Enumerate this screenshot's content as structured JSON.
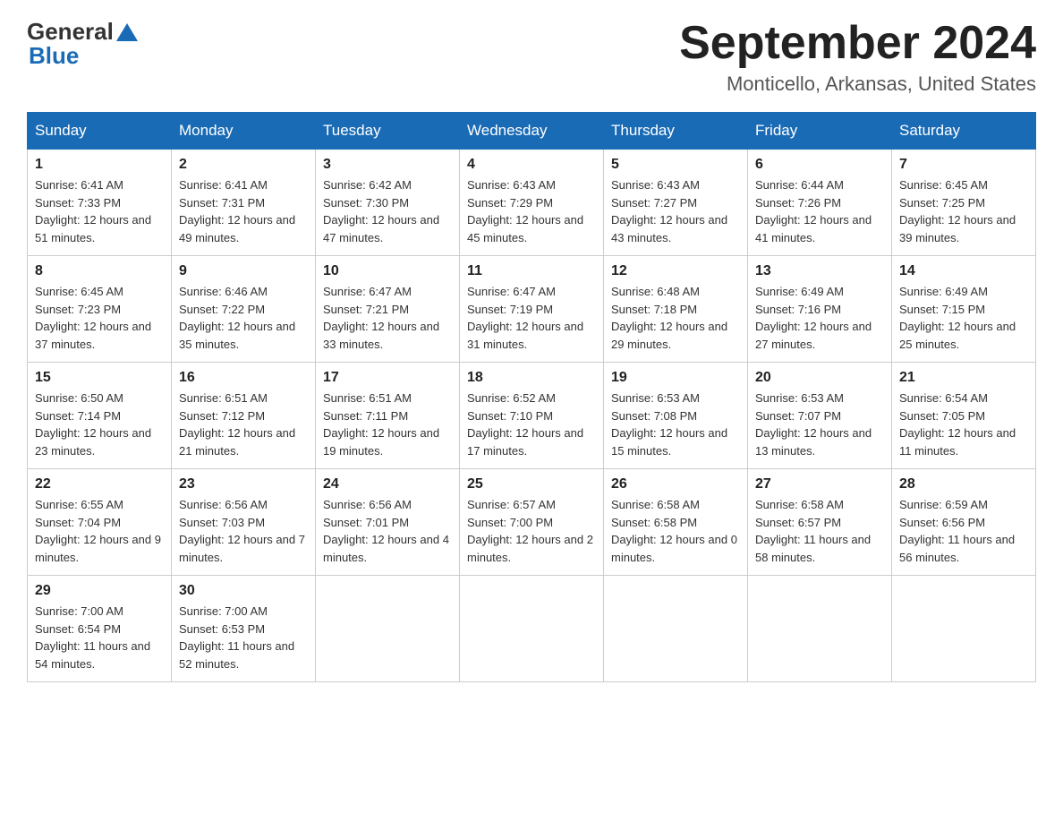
{
  "logo": {
    "general": "General",
    "blue": "Blue"
  },
  "header": {
    "title": "September 2024",
    "subtitle": "Monticello, Arkansas, United States"
  },
  "days_of_week": [
    "Sunday",
    "Monday",
    "Tuesday",
    "Wednesday",
    "Thursday",
    "Friday",
    "Saturday"
  ],
  "weeks": [
    [
      {
        "day": "1",
        "sunrise": "6:41 AM",
        "sunset": "7:33 PM",
        "daylight": "12 hours and 51 minutes."
      },
      {
        "day": "2",
        "sunrise": "6:41 AM",
        "sunset": "7:31 PM",
        "daylight": "12 hours and 49 minutes."
      },
      {
        "day": "3",
        "sunrise": "6:42 AM",
        "sunset": "7:30 PM",
        "daylight": "12 hours and 47 minutes."
      },
      {
        "day": "4",
        "sunrise": "6:43 AM",
        "sunset": "7:29 PM",
        "daylight": "12 hours and 45 minutes."
      },
      {
        "day": "5",
        "sunrise": "6:43 AM",
        "sunset": "7:27 PM",
        "daylight": "12 hours and 43 minutes."
      },
      {
        "day": "6",
        "sunrise": "6:44 AM",
        "sunset": "7:26 PM",
        "daylight": "12 hours and 41 minutes."
      },
      {
        "day": "7",
        "sunrise": "6:45 AM",
        "sunset": "7:25 PM",
        "daylight": "12 hours and 39 minutes."
      }
    ],
    [
      {
        "day": "8",
        "sunrise": "6:45 AM",
        "sunset": "7:23 PM",
        "daylight": "12 hours and 37 minutes."
      },
      {
        "day": "9",
        "sunrise": "6:46 AM",
        "sunset": "7:22 PM",
        "daylight": "12 hours and 35 minutes."
      },
      {
        "day": "10",
        "sunrise": "6:47 AM",
        "sunset": "7:21 PM",
        "daylight": "12 hours and 33 minutes."
      },
      {
        "day": "11",
        "sunrise": "6:47 AM",
        "sunset": "7:19 PM",
        "daylight": "12 hours and 31 minutes."
      },
      {
        "day": "12",
        "sunrise": "6:48 AM",
        "sunset": "7:18 PM",
        "daylight": "12 hours and 29 minutes."
      },
      {
        "day": "13",
        "sunrise": "6:49 AM",
        "sunset": "7:16 PM",
        "daylight": "12 hours and 27 minutes."
      },
      {
        "day": "14",
        "sunrise": "6:49 AM",
        "sunset": "7:15 PM",
        "daylight": "12 hours and 25 minutes."
      }
    ],
    [
      {
        "day": "15",
        "sunrise": "6:50 AM",
        "sunset": "7:14 PM",
        "daylight": "12 hours and 23 minutes."
      },
      {
        "day": "16",
        "sunrise": "6:51 AM",
        "sunset": "7:12 PM",
        "daylight": "12 hours and 21 minutes."
      },
      {
        "day": "17",
        "sunrise": "6:51 AM",
        "sunset": "7:11 PM",
        "daylight": "12 hours and 19 minutes."
      },
      {
        "day": "18",
        "sunrise": "6:52 AM",
        "sunset": "7:10 PM",
        "daylight": "12 hours and 17 minutes."
      },
      {
        "day": "19",
        "sunrise": "6:53 AM",
        "sunset": "7:08 PM",
        "daylight": "12 hours and 15 minutes."
      },
      {
        "day": "20",
        "sunrise": "6:53 AM",
        "sunset": "7:07 PM",
        "daylight": "12 hours and 13 minutes."
      },
      {
        "day": "21",
        "sunrise": "6:54 AM",
        "sunset": "7:05 PM",
        "daylight": "12 hours and 11 minutes."
      }
    ],
    [
      {
        "day": "22",
        "sunrise": "6:55 AM",
        "sunset": "7:04 PM",
        "daylight": "12 hours and 9 minutes."
      },
      {
        "day": "23",
        "sunrise": "6:56 AM",
        "sunset": "7:03 PM",
        "daylight": "12 hours and 7 minutes."
      },
      {
        "day": "24",
        "sunrise": "6:56 AM",
        "sunset": "7:01 PM",
        "daylight": "12 hours and 4 minutes."
      },
      {
        "day": "25",
        "sunrise": "6:57 AM",
        "sunset": "7:00 PM",
        "daylight": "12 hours and 2 minutes."
      },
      {
        "day": "26",
        "sunrise": "6:58 AM",
        "sunset": "6:58 PM",
        "daylight": "12 hours and 0 minutes."
      },
      {
        "day": "27",
        "sunrise": "6:58 AM",
        "sunset": "6:57 PM",
        "daylight": "11 hours and 58 minutes."
      },
      {
        "day": "28",
        "sunrise": "6:59 AM",
        "sunset": "6:56 PM",
        "daylight": "11 hours and 56 minutes."
      }
    ],
    [
      {
        "day": "29",
        "sunrise": "7:00 AM",
        "sunset": "6:54 PM",
        "daylight": "11 hours and 54 minutes."
      },
      {
        "day": "30",
        "sunrise": "7:00 AM",
        "sunset": "6:53 PM",
        "daylight": "11 hours and 52 minutes."
      },
      null,
      null,
      null,
      null,
      null
    ]
  ]
}
